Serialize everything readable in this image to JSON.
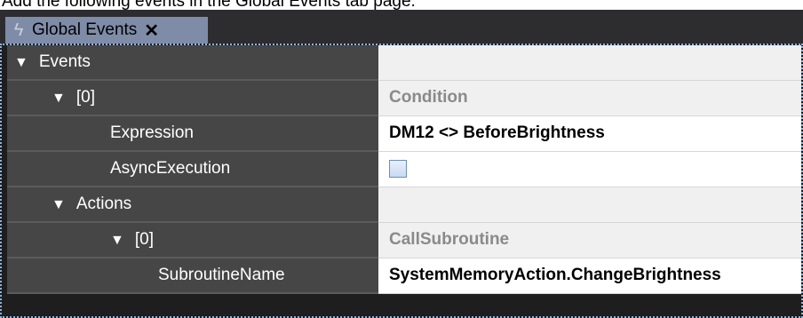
{
  "caption": "Add the following events in the Global Events tab page.",
  "tab": {
    "icon": "lightning-icon",
    "label": "Global Events",
    "close_glyph": "✕"
  },
  "rows": [
    {
      "name": "Events",
      "expander": "▼",
      "value": ""
    },
    {
      "name": "[0]",
      "expander": "▼",
      "value": "Condition"
    },
    {
      "name": "Expression",
      "expander": "",
      "value": "DM12 <> BeforeBrightness"
    },
    {
      "name": "AsyncExecution",
      "expander": "",
      "value": ""
    },
    {
      "name": "Actions",
      "expander": "▼",
      "value": ""
    },
    {
      "name": "[0]",
      "expander": "▼",
      "value": "CallSubroutine"
    },
    {
      "name": "SubroutineName",
      "expander": "",
      "value": "SystemMemoryAction.ChangeBrightness"
    }
  ],
  "colors": {
    "tab_active": "#7f8ca8",
    "row_name_bg": "#464646",
    "category_text": "#8a8a8a"
  }
}
